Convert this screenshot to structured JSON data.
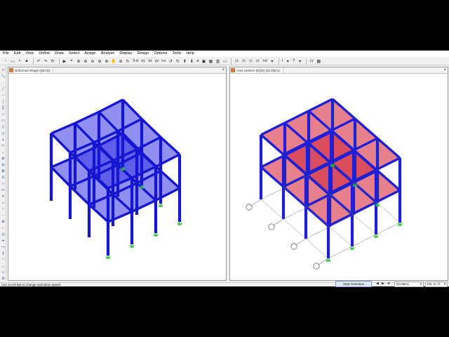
{
  "menu": [
    "File",
    "Edit",
    "View",
    "Define",
    "Draw",
    "Select",
    "Assign",
    "Analyze",
    "Display",
    "Design",
    "Options",
    "Tools",
    "Help"
  ],
  "toolbar": {
    "icons": [
      "new-icon",
      "open-icon",
      "save-icon",
      "lock-icon",
      "undo-icon",
      "redo-icon",
      "refresh-icon",
      "run-icon",
      "pointer-icon",
      "zoom-window-icon",
      "zoom-in-icon",
      "zoom-out-icon",
      "zoom-fit-icon",
      "zoom-previous-icon",
      "pan-icon",
      "zoom-extents-icon",
      "rotate-icon"
    ],
    "views": [
      "3-d",
      "xy",
      "xz",
      "yz",
      "nv"
    ],
    "icons2": [
      "rotate-left-icon",
      "rotate-right-icon",
      "up-icon",
      "down-icon",
      "perspective-icon",
      "shrink-icon"
    ],
    "views2": [
      "ø"
    ],
    "icons3": [
      "frame-icon",
      "column-icon",
      "beam-icon",
      "brace-icon",
      "floor-icon",
      "wall-icon",
      "nd-label"
    ],
    "right_labels": [
      "nd",
      "I",
      "T"
    ]
  },
  "left_pane": {
    "title": "Deformed Shape (DEAD)"
  },
  "right_pane": {
    "title": "Area Uniform (EQX) (GLOBAL)"
  },
  "status": {
    "message": "Use Scroll Bar to change animation speed",
    "stop_button": "Stop Animation",
    "coord_system": "GLOBAL",
    "units": "KN, m, C"
  },
  "colors": {
    "frame": "#1f1fd6",
    "area_left": "#3d3dea",
    "area_right": "#d42c40",
    "support": "#27c23a"
  }
}
